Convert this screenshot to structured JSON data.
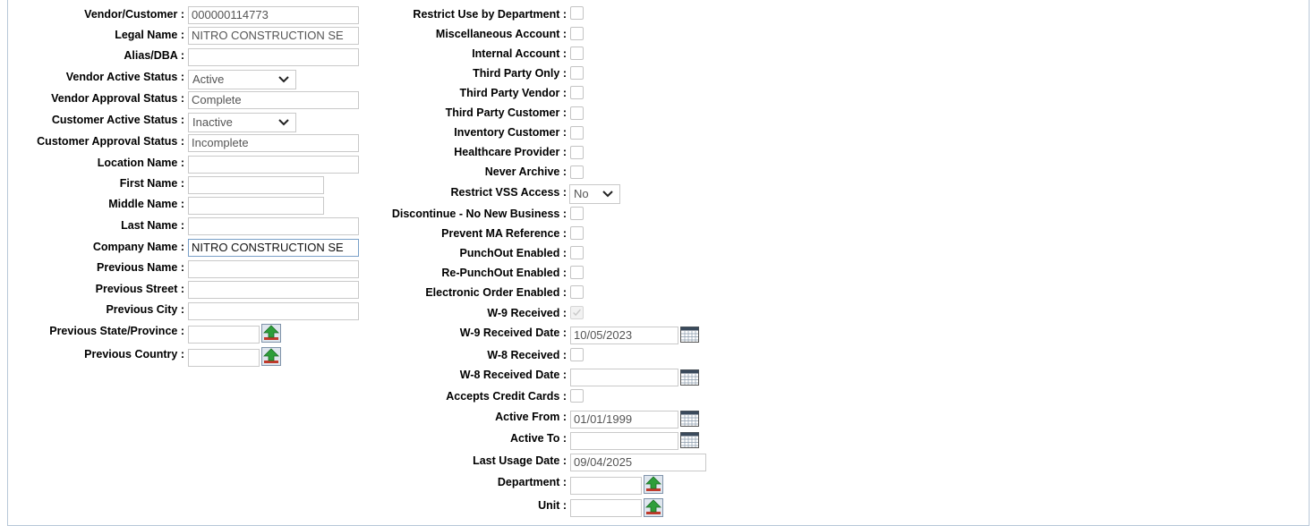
{
  "left": {
    "vendor_customer": {
      "label": "Vendor/Customer :",
      "value": "000000114773"
    },
    "legal_name": {
      "label": "Legal Name :",
      "value": "NITRO CONSTRUCTION SE"
    },
    "alias": {
      "label": "Alias/DBA :",
      "value": ""
    },
    "vendor_active": {
      "label": "Vendor Active Status :",
      "value": "Active"
    },
    "vendor_approval": {
      "label": "Vendor Approval Status :",
      "value": "Complete"
    },
    "customer_active": {
      "label": "Customer Active Status :",
      "value": "Inactive"
    },
    "customer_approval": {
      "label": "Customer Approval Status :",
      "value": "Incomplete"
    },
    "location_name": {
      "label": "Location Name :",
      "value": ""
    },
    "first_name": {
      "label": "First Name :",
      "value": ""
    },
    "middle_name": {
      "label": "Middle Name :",
      "value": ""
    },
    "last_name": {
      "label": "Last Name :",
      "value": ""
    },
    "company_name": {
      "label": "Company Name :",
      "value": "NITRO CONSTRUCTION SE"
    },
    "previous_name": {
      "label": "Previous Name :",
      "value": ""
    },
    "previous_street": {
      "label": "Previous Street :",
      "value": ""
    },
    "previous_city": {
      "label": "Previous City :",
      "value": ""
    },
    "previous_state": {
      "label": "Previous State/Province :",
      "value": ""
    },
    "previous_country": {
      "label": "Previous Country :",
      "value": ""
    }
  },
  "right": {
    "restrict_dept": {
      "label": "Restrict Use by Department :",
      "checked": false
    },
    "misc_account": {
      "label": "Miscellaneous Account :",
      "checked": false
    },
    "internal_account": {
      "label": "Internal Account :",
      "checked": false
    },
    "third_party_only": {
      "label": "Third Party Only :",
      "checked": false
    },
    "third_party_vendor": {
      "label": "Third Party Vendor :",
      "checked": false
    },
    "third_party_customer": {
      "label": "Third Party Customer :",
      "checked": false
    },
    "inventory_customer": {
      "label": "Inventory Customer :",
      "checked": false
    },
    "healthcare_provider": {
      "label": "Healthcare Provider :",
      "checked": false
    },
    "never_archive": {
      "label": "Never Archive :",
      "checked": false
    },
    "restrict_vss": {
      "label": "Restrict VSS Access :",
      "value": "No"
    },
    "discontinue": {
      "label": "Discontinue - No New Business :",
      "checked": false
    },
    "prevent_ma": {
      "label": "Prevent MA Reference :",
      "checked": false
    },
    "punchout": {
      "label": "PunchOut Enabled :",
      "checked": false
    },
    "repunchout": {
      "label": "Re-PunchOut Enabled :",
      "checked": false
    },
    "electronic_order": {
      "label": "Electronic Order Enabled :",
      "checked": false
    },
    "w9_received": {
      "label": "W-9 Received :",
      "checked": true
    },
    "w9_date": {
      "label": "W-9 Received Date :",
      "value": "10/05/2023"
    },
    "w8_received": {
      "label": "W-8 Received :",
      "checked": false
    },
    "w8_date": {
      "label": "W-8 Received Date :",
      "value": ""
    },
    "accepts_cc": {
      "label": "Accepts Credit Cards :",
      "checked": false
    },
    "active_from": {
      "label": "Active From :",
      "value": "01/01/1999"
    },
    "active_to": {
      "label": "Active To :",
      "value": ""
    },
    "last_usage": {
      "label": "Last Usage Date :",
      "value": "09/04/2025"
    },
    "department": {
      "label": "Department :",
      "value": ""
    },
    "unit": {
      "label": "Unit :",
      "value": ""
    }
  },
  "icons": {
    "lookup": "lookup-arrow-icon",
    "calendar": "calendar-icon",
    "dropdown": "chevron-down-icon"
  }
}
